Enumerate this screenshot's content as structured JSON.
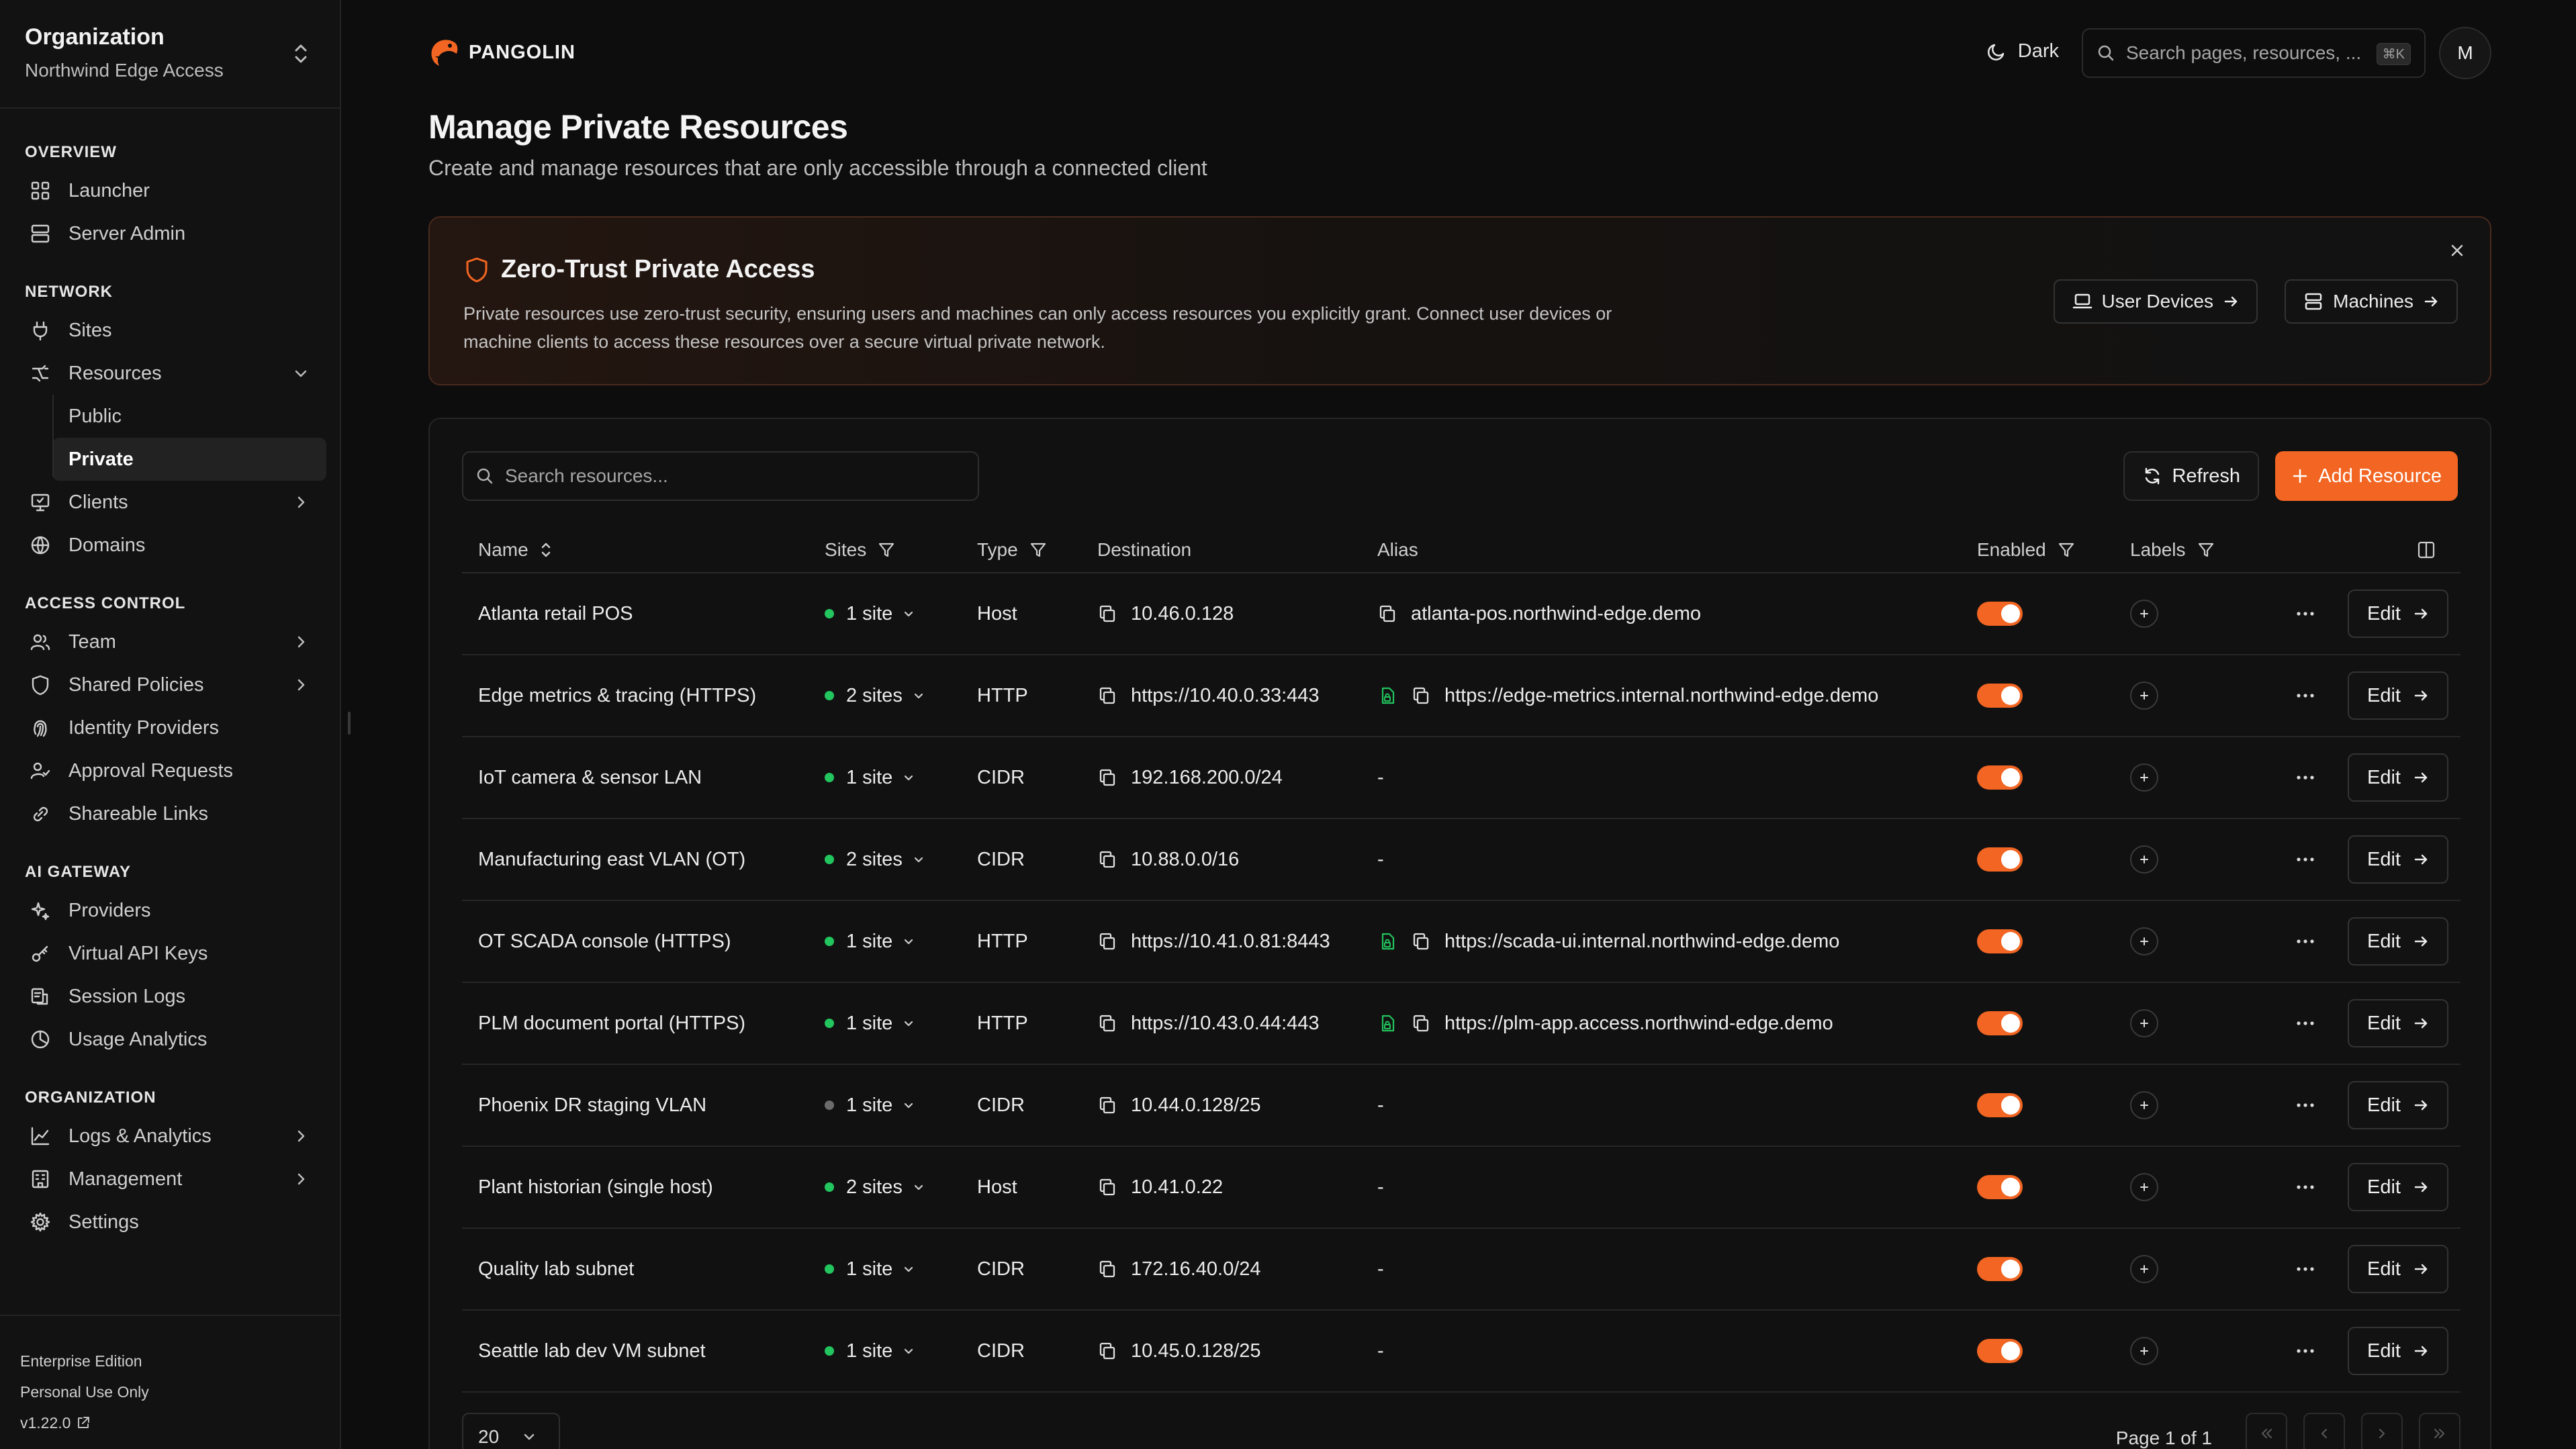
{
  "sidebar": {
    "org_title": "Organization",
    "org_name": "Northwind Edge Access",
    "sections": [
      {
        "label": "OVERVIEW",
        "items": [
          {
            "label": "Launcher",
            "icon": "grid-icon"
          },
          {
            "label": "Server Admin",
            "icon": "server-icon"
          }
        ]
      },
      {
        "label": "NETWORK",
        "items": [
          {
            "label": "Sites",
            "icon": "plug-icon"
          },
          {
            "label": "Resources",
            "icon": "resources-icon",
            "expanded": true,
            "subitems": [
              "Public",
              "Private"
            ]
          },
          {
            "label": "Clients",
            "icon": "monitor-icon",
            "has_children": true
          },
          {
            "label": "Domains",
            "icon": "globe-icon"
          }
        ]
      },
      {
        "label": "ACCESS CONTROL",
        "items": [
          {
            "label": "Team",
            "icon": "users-icon",
            "has_children": true
          },
          {
            "label": "Shared Policies",
            "icon": "shield-icon",
            "has_children": true
          },
          {
            "label": "Identity Providers",
            "icon": "fingerprint-icon"
          },
          {
            "label": "Approval Requests",
            "icon": "user-check-icon"
          },
          {
            "label": "Shareable Links",
            "icon": "link-icon"
          }
        ]
      },
      {
        "label": "AI GATEWAY",
        "items": [
          {
            "label": "Providers",
            "icon": "sparkles-icon"
          },
          {
            "label": "Virtual API Keys",
            "icon": "key-icon"
          },
          {
            "label": "Session Logs",
            "icon": "logs-icon"
          },
          {
            "label": "Usage Analytics",
            "icon": "analytics-icon"
          }
        ]
      },
      {
        "label": "ORGANIZATION",
        "items": [
          {
            "label": "Logs & Analytics",
            "icon": "chart-icon",
            "has_children": true
          },
          {
            "label": "Management",
            "icon": "building-icon",
            "has_children": true
          },
          {
            "label": "Settings",
            "icon": "gear-icon"
          }
        ]
      }
    ],
    "active_subitem": "Private",
    "footer": {
      "edition": "Enterprise Edition",
      "license": "Personal Use Only",
      "version": "v1.22.0"
    }
  },
  "header": {
    "brand": "PANGOLIN",
    "theme_label": "Dark",
    "search_placeholder": "Search pages, resources, ...",
    "search_shortcut": "⌘K",
    "avatar_initial": "M"
  },
  "page": {
    "title": "Manage Private Resources",
    "subtitle": "Create and manage resources that are only accessible through a connected client"
  },
  "banner": {
    "title": "Zero-Trust Private Access",
    "text": "Private resources use zero-trust security, ensuring users and machines can only access resources you explicitly grant. Connect user devices or machine clients to access these resources over a secure virtual private network.",
    "user_devices_label": "User Devices",
    "machines_label": "Machines"
  },
  "toolbar": {
    "search_placeholder": "Search resources...",
    "refresh_label": "Refresh",
    "add_label": "Add Resource"
  },
  "table": {
    "columns": {
      "name": "Name",
      "sites": "Sites",
      "type": "Type",
      "destination": "Destination",
      "alias": "Alias",
      "enabled": "Enabled",
      "labels": "Labels"
    },
    "edit_label": "Edit",
    "rows": [
      {
        "name": "Atlanta retail POS",
        "sites": "1 site",
        "site_status": "online",
        "type": "Host",
        "destination": "10.46.0.128",
        "alias": "atlanta-pos.northwind-edge.demo",
        "alias_kind": "host",
        "enabled": true
      },
      {
        "name": "Edge metrics & tracing (HTTPS)",
        "sites": "2 sites",
        "site_status": "online",
        "type": "HTTP",
        "destination": "https://10.40.0.33:443",
        "alias": "https://edge-metrics.internal.northwind-edge.demo",
        "alias_kind": "https",
        "enabled": true
      },
      {
        "name": "IoT camera & sensor LAN",
        "sites": "1 site",
        "site_status": "online",
        "type": "CIDR",
        "destination": "192.168.200.0/24",
        "alias": "-",
        "alias_kind": "none",
        "enabled": true
      },
      {
        "name": "Manufacturing east VLAN (OT)",
        "sites": "2 sites",
        "site_status": "online",
        "type": "CIDR",
        "destination": "10.88.0.0/16",
        "alias": "-",
        "alias_kind": "none",
        "enabled": true
      },
      {
        "name": "OT SCADA console (HTTPS)",
        "sites": "1 site",
        "site_status": "online",
        "type": "HTTP",
        "destination": "https://10.41.0.81:8443",
        "alias": "https://scada-ui.internal.northwind-edge.demo",
        "alias_kind": "https",
        "enabled": true
      },
      {
        "name": "PLM document portal (HTTPS)",
        "sites": "1 site",
        "site_status": "online",
        "type": "HTTP",
        "destination": "https://10.43.0.44:443",
        "alias": "https://plm-app.access.northwind-edge.demo",
        "alias_kind": "https",
        "enabled": true
      },
      {
        "name": "Phoenix DR staging VLAN",
        "sites": "1 site",
        "site_status": "offline",
        "type": "CIDR",
        "destination": "10.44.0.128/25",
        "alias": "-",
        "alias_kind": "none",
        "enabled": true
      },
      {
        "name": "Plant historian (single host)",
        "sites": "2 sites",
        "site_status": "online",
        "type": "Host",
        "destination": "10.41.0.22",
        "alias": "-",
        "alias_kind": "none",
        "enabled": true
      },
      {
        "name": "Quality lab subnet",
        "sites": "1 site",
        "site_status": "online",
        "type": "CIDR",
        "destination": "172.16.40.0/24",
        "alias": "-",
        "alias_kind": "none",
        "enabled": true
      },
      {
        "name": "Seattle lab dev VM subnet",
        "sites": "1 site",
        "site_status": "online",
        "type": "CIDR",
        "destination": "10.45.0.128/25",
        "alias": "-",
        "alias_kind": "none",
        "enabled": true
      }
    ]
  },
  "pagination": {
    "page_size": "20",
    "page_info": "Page 1 of 1"
  },
  "colors": {
    "accent": "#f26522",
    "status_online": "#22c55e",
    "status_offline": "#6b6b6b",
    "background": "#0d0d0d"
  }
}
